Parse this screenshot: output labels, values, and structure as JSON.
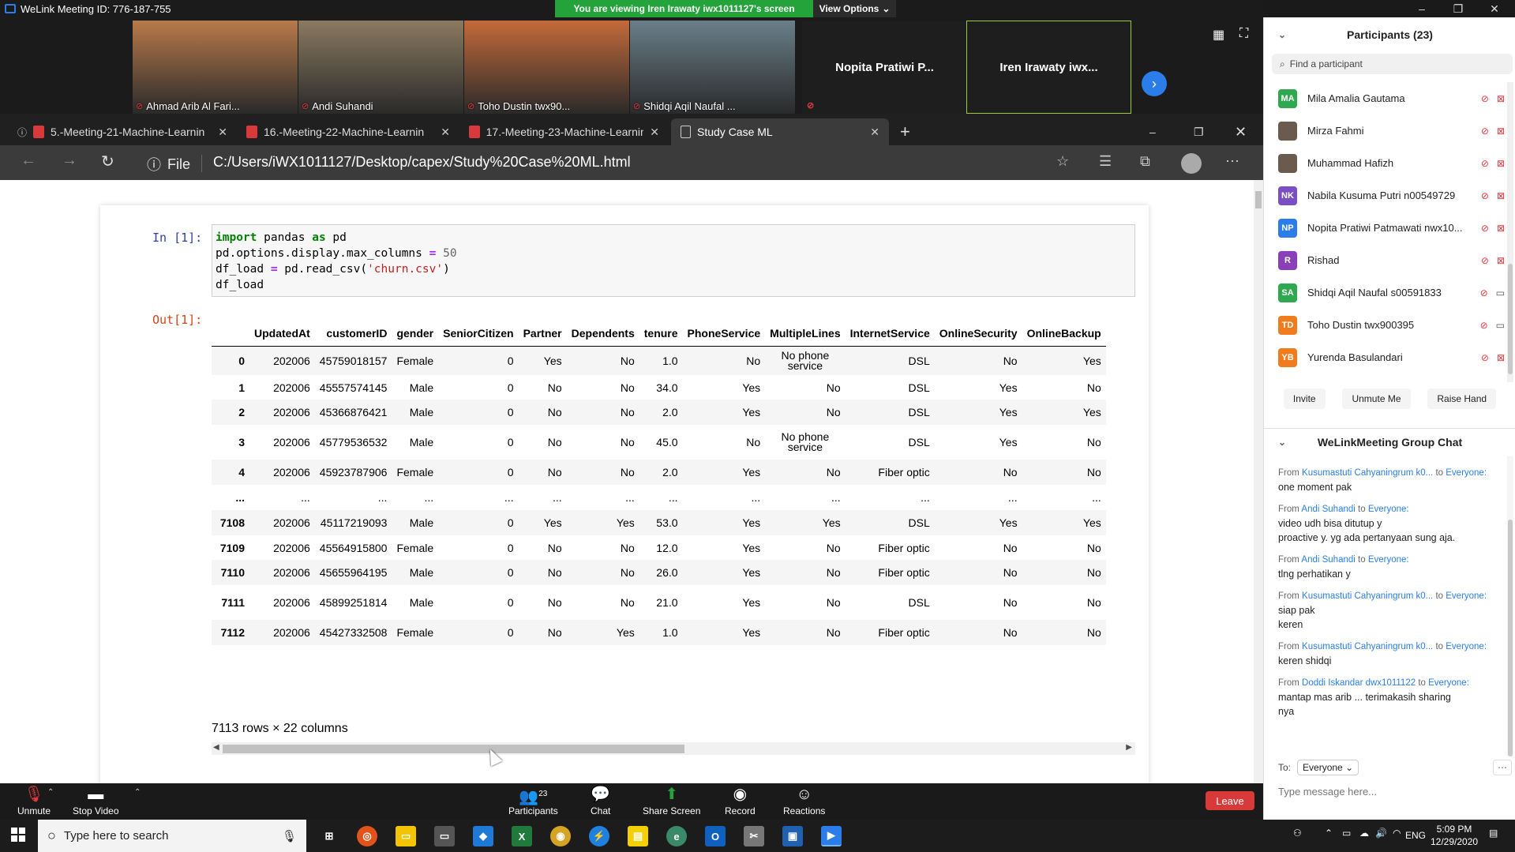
{
  "window": {
    "title": "WeLink Meeting ID: 776-187-755"
  },
  "banner": {
    "viewing_text": "You are viewing Iren Irawaty iwx1011127's screen",
    "view_options_label": "View Options"
  },
  "video_tiles": [
    {
      "name": "Ahmad Arib Al Fari...",
      "bg": "#b87a4a"
    },
    {
      "name": "Andi Suhandi",
      "bg": "#8a7a60"
    },
    {
      "name": "Toho Dustin twx90...",
      "bg": "#c46a3a"
    },
    {
      "name": "Shidqi Aqil Naufal ...",
      "bg": "#6a7f8a"
    }
  ],
  "video_text_tiles": [
    "Nopita Pratiwi P...",
    "Iren Irawaty iwx..."
  ],
  "browser": {
    "tabs": [
      {
        "label": "5.-Meeting-21-Machine-Learnin",
        "overlay": "Recording"
      },
      {
        "label": "16.-Meeting-22-Machine-Learnin"
      },
      {
        "label": "17.-Meeting-23-Machine-Learnin"
      },
      {
        "label": "Study Case ML"
      }
    ],
    "file_label": "File",
    "url": "C:/Users/iWX1011127/Desktop/capex/Study%20Case%20ML.html"
  },
  "notebook": {
    "in_prompt": "In [1]:",
    "out_prompt": "Out[1]:",
    "code_lines": [
      [
        "import",
        " pandas ",
        "as",
        " pd"
      ],
      [
        "pd.options.display.max_columns ",
        "=",
        " ",
        "50"
      ],
      [
        "df_load ",
        "=",
        " pd.read_csv(",
        "'churn.csv'",
        ")"
      ],
      [
        "df_load"
      ]
    ],
    "columns": [
      "",
      "UpdatedAt",
      "customerID",
      "gender",
      "SeniorCitizen",
      "Partner",
      "Dependents",
      "tenure",
      "PhoneService",
      "MultipleLines",
      "InternetService",
      "OnlineSecurity",
      "OnlineBackup"
    ],
    "rows": [
      [
        "0",
        "202006",
        "45759018157",
        "Female",
        "0",
        "Yes",
        "No",
        "1.0",
        "No",
        "No phone service",
        "DSL",
        "No",
        "Yes"
      ],
      [
        "1",
        "202006",
        "45557574145",
        "Male",
        "0",
        "No",
        "No",
        "34.0",
        "Yes",
        "No",
        "DSL",
        "Yes",
        "No"
      ],
      [
        "2",
        "202006",
        "45366876421",
        "Male",
        "0",
        "No",
        "No",
        "2.0",
        "Yes",
        "No",
        "DSL",
        "Yes",
        "Yes"
      ],
      [
        "3",
        "202006",
        "45779536532",
        "Male",
        "0",
        "No",
        "No",
        "45.0",
        "No",
        "No phone service",
        "DSL",
        "Yes",
        "No"
      ],
      [
        "4",
        "202006",
        "45923787906",
        "Female",
        "0",
        "No",
        "No",
        "2.0",
        "Yes",
        "No",
        "Fiber optic",
        "No",
        "No"
      ],
      [
        "...",
        "...",
        "...",
        "...",
        "...",
        "...",
        "...",
        "...",
        "...",
        "...",
        "...",
        "...",
        "..."
      ],
      [
        "7108",
        "202006",
        "45117219093",
        "Male",
        "0",
        "Yes",
        "Yes",
        "53.0",
        "Yes",
        "Yes",
        "DSL",
        "Yes",
        "Yes"
      ],
      [
        "7109",
        "202006",
        "45564915800",
        "Female",
        "0",
        "No",
        "No",
        "12.0",
        "Yes",
        "No",
        "Fiber optic",
        "No",
        "No"
      ],
      [
        "7110",
        "202006",
        "45655964195",
        "Male",
        "0",
        "No",
        "No",
        "26.0",
        "Yes",
        "No",
        "Fiber optic",
        "No",
        "No"
      ],
      [
        "7111",
        "202006",
        "45899251814",
        "Male",
        "0",
        "No",
        "No",
        "21.0",
        "Yes",
        "No",
        "DSL",
        "No",
        "No"
      ],
      [
        "7112",
        "202006",
        "45427332508",
        "Female",
        "0",
        "No",
        "Yes",
        "1.0",
        "Yes",
        "No",
        "Fiber optic",
        "No",
        "No"
      ]
    ],
    "shape_text": "7113 rows × 22 columns"
  },
  "toolbar": {
    "unmute": "Unmute",
    "stop_video": "Stop Video",
    "participants": "Participants",
    "participants_count": "23",
    "chat": "Chat",
    "share_screen": "Share Screen",
    "record": "Record",
    "reactions": "Reactions",
    "leave": "Leave"
  },
  "participants": {
    "title": "Participants (23)",
    "search_placeholder": "Find a participant",
    "list": [
      {
        "initials": "MA",
        "name": "Mila Amalia Gautama",
        "color": "#2fa84f",
        "video": "off"
      },
      {
        "initials": "",
        "name": "Mirza Fahmi",
        "color": "photo",
        "video": "off"
      },
      {
        "initials": "",
        "name": "Muhammad Hafizh",
        "color": "photo",
        "video": "off"
      },
      {
        "initials": "NK",
        "name": "Nabila Kusuma Putri n00549729",
        "color": "#7b4fc4",
        "video": "off"
      },
      {
        "initials": "NP",
        "name": "Nopita Pratiwi Patmawati nwx10...",
        "color": "#2b7de9",
        "video": "off"
      },
      {
        "initials": "R",
        "name": "Rishad",
        "color": "#8a3fb8",
        "video": "off"
      },
      {
        "initials": "SA",
        "name": "Shidqi Aqil Naufal s00591833",
        "color": "#2fa84f",
        "video": "on"
      },
      {
        "initials": "TD",
        "name": "Toho Dustin twx900395",
        "color": "#f07c1e",
        "video": "on"
      },
      {
        "initials": "YB",
        "name": "Yurenda Basulandari",
        "color": "#f07c1e",
        "video": "off"
      }
    ],
    "buttons": [
      "Invite",
      "Unmute Me",
      "Raise Hand"
    ]
  },
  "chat": {
    "title": "WeLinkMeeting Group Chat",
    "from_label": "From",
    "to_label": "to",
    "messages": [
      {
        "from": "Kusumastuti Cahyaningrum k0...",
        "to": "Everyone:",
        "lines": [
          "one moment pak"
        ]
      },
      {
        "from": "Andi Suhandi",
        "to": "Everyone:",
        "lines": [
          "video udh bisa ditutup y",
          "proactive y. yg ada pertanyaan sung aja."
        ]
      },
      {
        "from": "Andi Suhandi",
        "to": "Everyone:",
        "lines": [
          "tlng perhatikan y"
        ]
      },
      {
        "from": "Kusumastuti Cahyaningrum k0...",
        "to": "Everyone:",
        "lines": [
          "siap pak",
          "keren"
        ]
      },
      {
        "from": "Kusumastuti Cahyaningrum k0...",
        "to": "Everyone:",
        "lines": [
          "keren shidqi"
        ]
      },
      {
        "from": "Doddi Iskandar dwx1011122",
        "to": "Everyone:",
        "lines": [
          "mantap mas arib ... terimakasih sharing",
          "nya"
        ]
      }
    ],
    "to_field_label": "To:",
    "to_value": "Everyone",
    "input_placeholder": "Type message here..."
  },
  "taskbar": {
    "search_placeholder": "Type here to search",
    "lang": "ENG",
    "time": "5:09 PM",
    "date": "12/29/2020"
  }
}
